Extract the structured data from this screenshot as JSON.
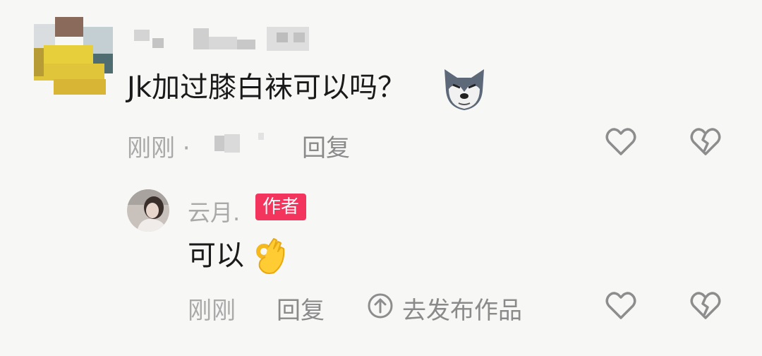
{
  "comment": {
    "text": "Jk加过膝白袜可以吗？",
    "time": "刚刚 ·",
    "reply_label": "回复"
  },
  "author_reply": {
    "name": "云月.",
    "badge": "作者",
    "text": "可以",
    "time": "刚刚",
    "reply_label": "回复",
    "post_label": "去发布作品"
  },
  "colors": {
    "badge": "#f3345c",
    "meta": "#a9a9a9"
  },
  "icons": [
    "dog-emoji-icon",
    "ok-hand-emoji-icon",
    "heart-outline-icon",
    "broken-heart-icon",
    "upload-arrow-icon"
  ]
}
